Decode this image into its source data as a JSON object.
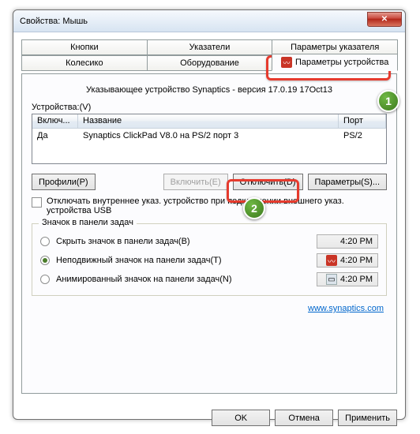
{
  "title": "Свойства: Мышь",
  "tabs": {
    "row1": [
      "Кнопки",
      "Указатели",
      "Параметры указателя"
    ],
    "row2": [
      "Колесико",
      "Оборудование",
      "Параметры устройства"
    ]
  },
  "info": "Указывающее устройство Synaptics - версия 17.0.19 17Oct13",
  "devLabel": "Устройства:(V)",
  "cols": {
    "c1": "Включ...",
    "c2": "Название",
    "c3": "Порт"
  },
  "row": {
    "c1": "Да",
    "c2": "Synaptics ClickPad V8.0 на PS/2 порт 3",
    "c3": "PS/2"
  },
  "buttons": {
    "profiles": "Профили(P)",
    "enable": "Включить(E)",
    "disable": "Отключить(D)",
    "params": "Параметры(S)..."
  },
  "checkbox": "Отключать внутреннее указ. устройство при подключении внешнего указ. устройства USB",
  "groupTitle": "Значок в панели задач",
  "radios": {
    "r1": "Скрыть значок в панели задач(B)",
    "r2": "Неподвижный значок на панели задач(T)",
    "r3": "Анимированный значок на панели задач(N)"
  },
  "time": "4:20 PM",
  "link": "www.synaptics.com",
  "footer": {
    "ok": "OK",
    "cancel": "Отмена",
    "apply": "Применить"
  },
  "badges": {
    "b1": "1",
    "b2": "2"
  }
}
